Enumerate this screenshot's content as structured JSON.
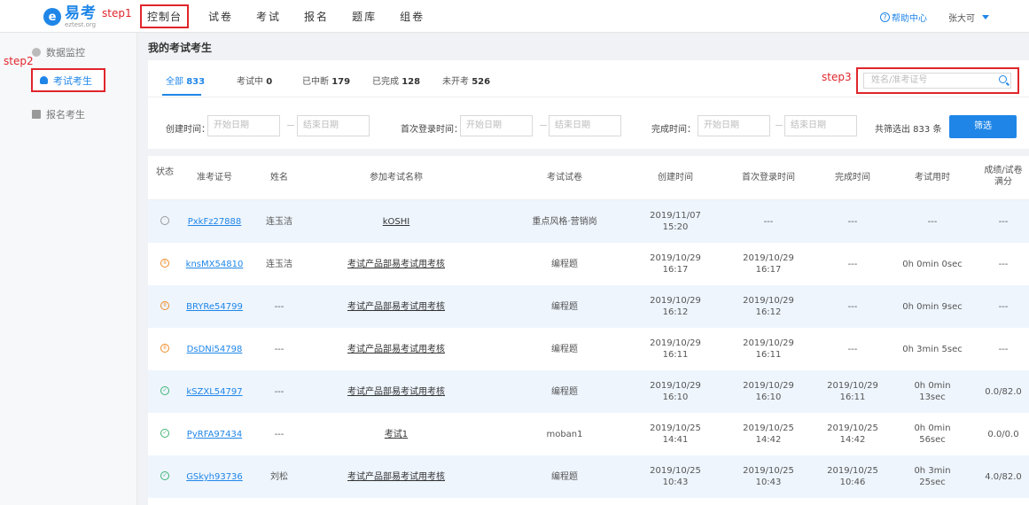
{
  "annotations": {
    "step1": "step1",
    "step2": "step2",
    "step3": "step3"
  },
  "brand": {
    "logo_main": "易考",
    "logo_sub": "eztest.org"
  },
  "nav": {
    "items": [
      "控制台",
      "试卷",
      "考试",
      "报名",
      "题库",
      "组卷"
    ]
  },
  "header": {
    "help": "帮助中心",
    "user": "张大可"
  },
  "sidebar": {
    "items": [
      "数据监控",
      "考试考生",
      "报名考生"
    ]
  },
  "main": {
    "title": "我的考试考生",
    "tabs": [
      {
        "label": "全部",
        "count": "833"
      },
      {
        "label": "考试中",
        "count": "0"
      },
      {
        "label": "已中断",
        "count": "179"
      },
      {
        "label": "已完成",
        "count": "128"
      },
      {
        "label": "未开考",
        "count": "526"
      }
    ],
    "search_placeholder": "姓名/准考证号",
    "filters": {
      "created_label": "创建时间：",
      "first_login_label": "首次登录时间：",
      "completed_label": "完成时间：",
      "start_placeholder": "开始日期",
      "end_placeholder": "结束日期",
      "count_text": "共筛选出 833 条",
      "filter_button": "筛选"
    },
    "columns": [
      "状态",
      "准考证号",
      "姓名",
      "参加考试名称",
      "考试试卷",
      "创建时间",
      "首次登录时间",
      "完成时间",
      "考试用时",
      "成绩/试卷满分"
    ],
    "rows": [
      {
        "status": "not-started",
        "ticket": "PxkFz27888",
        "name": "连玉洁",
        "exam": "kOSHI",
        "paper": "重点风格·营销岗",
        "created": [
          "2019/11/07",
          "15:20"
        ],
        "first_login": [
          "---"
        ],
        "completed": [
          "---"
        ],
        "duration": [
          "---"
        ],
        "score": "---"
      },
      {
        "status": "interrupted",
        "ticket": "knsMX54810",
        "name": "连玉洁",
        "exam": "考试产品部易考试用考核",
        "paper": "编程题",
        "created": [
          "2019/10/29",
          "16:17"
        ],
        "first_login": [
          "2019/10/29",
          "16:17"
        ],
        "completed": [
          "---"
        ],
        "duration": [
          "0h 0min 0sec"
        ],
        "score": "---"
      },
      {
        "status": "interrupted",
        "ticket": "BRYRe54799",
        "name": "---",
        "exam": "考试产品部易考试用考核",
        "paper": "编程题",
        "created": [
          "2019/10/29",
          "16:12"
        ],
        "first_login": [
          "2019/10/29",
          "16:12"
        ],
        "completed": [
          "---"
        ],
        "duration": [
          "0h 0min 9sec"
        ],
        "score": "---"
      },
      {
        "status": "interrupted",
        "ticket": "DsDNi54798",
        "name": "---",
        "exam": "考试产品部易考试用考核",
        "paper": "编程题",
        "created": [
          "2019/10/29",
          "16:11"
        ],
        "first_login": [
          "2019/10/29",
          "16:11"
        ],
        "completed": [
          "---"
        ],
        "duration": [
          "0h 3min 5sec"
        ],
        "score": "---"
      },
      {
        "status": "completed",
        "ticket": "kSZXL54797",
        "name": "---",
        "exam": "考试产品部易考试用考核",
        "paper": "编程题",
        "created": [
          "2019/10/29",
          "16:10"
        ],
        "first_login": [
          "2019/10/29",
          "16:10"
        ],
        "completed": [
          "2019/10/29",
          "16:11"
        ],
        "duration": [
          "0h 0min",
          "13sec"
        ],
        "score": "0.0/82.0"
      },
      {
        "status": "completed",
        "ticket": "PyRFA97434",
        "name": "---",
        "exam": "考试1",
        "paper": "moban1",
        "created": [
          "2019/10/25",
          "14:41"
        ],
        "first_login": [
          "2019/10/25",
          "14:42"
        ],
        "completed": [
          "2019/10/25",
          "14:42"
        ],
        "duration": [
          "0h 0min",
          "56sec"
        ],
        "score": "0.0/0.0"
      },
      {
        "status": "completed",
        "ticket": "GSkyh93736",
        "name": "刘松",
        "exam": "考试产品部易考试用考核",
        "paper": "编程题",
        "created": [
          "2019/10/25",
          "10:43"
        ],
        "first_login": [
          "2019/10/25",
          "10:43"
        ],
        "completed": [
          "2019/10/25",
          "10:46"
        ],
        "duration": [
          "0h 3min",
          "25sec"
        ],
        "score": "4.0/82.0"
      }
    ]
  }
}
